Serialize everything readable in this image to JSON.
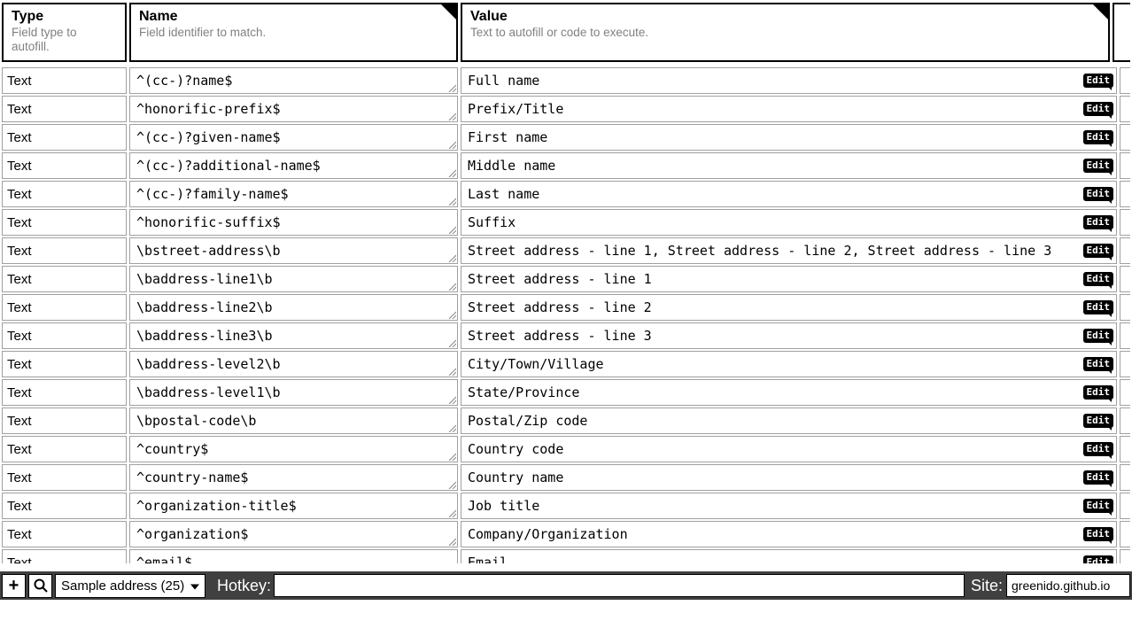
{
  "headers": {
    "type": {
      "title": "Type",
      "sub": "Field type to autofill."
    },
    "name": {
      "title": "Name",
      "sub": "Field identifier to match."
    },
    "value": {
      "title": "Value",
      "sub": "Text to autofill or code to execute."
    }
  },
  "edit_label": "Edit",
  "rows": [
    {
      "type": "Text",
      "name": "^(cc-)?name$",
      "value": "Full name"
    },
    {
      "type": "Text",
      "name": "^honorific-prefix$",
      "value": "Prefix/Title"
    },
    {
      "type": "Text",
      "name": "^(cc-)?given-name$",
      "value": "First name"
    },
    {
      "type": "Text",
      "name": "^(cc-)?additional-name$",
      "value": "Middle name"
    },
    {
      "type": "Text",
      "name": "^(cc-)?family-name$",
      "value": "Last name"
    },
    {
      "type": "Text",
      "name": "^honorific-suffix$",
      "value": "Suffix"
    },
    {
      "type": "Text",
      "name": "\\bstreet-address\\b",
      "value": "Street address - line 1, Street address - line 2, Street address - line 3"
    },
    {
      "type": "Text",
      "name": "\\baddress-line1\\b",
      "value": "Street address - line 1"
    },
    {
      "type": "Text",
      "name": "\\baddress-line2\\b",
      "value": "Street address - line 2"
    },
    {
      "type": "Text",
      "name": "\\baddress-line3\\b",
      "value": "Street address - line 3"
    },
    {
      "type": "Text",
      "name": "\\baddress-level2\\b",
      "value": "City/Town/Village"
    },
    {
      "type": "Text",
      "name": "\\baddress-level1\\b",
      "value": "State/Province"
    },
    {
      "type": "Text",
      "name": "\\bpostal-code\\b",
      "value": "Postal/Zip code"
    },
    {
      "type": "Text",
      "name": "^country$",
      "value": "Country code"
    },
    {
      "type": "Text",
      "name": "^country-name$",
      "value": "Country name"
    },
    {
      "type": "Text",
      "name": "^organization-title$",
      "value": "Job title"
    },
    {
      "type": "Text",
      "name": "^organization$",
      "value": "Company/Organization"
    },
    {
      "type": "Text",
      "name": "^email$",
      "value": "Email"
    }
  ],
  "bottombar": {
    "add_icon": "+",
    "select_label": "Sample address (25)",
    "hotkey_label": "Hotkey:",
    "hotkey_value": "",
    "site_label": "Site:",
    "site_value": "greenido.github.io"
  }
}
